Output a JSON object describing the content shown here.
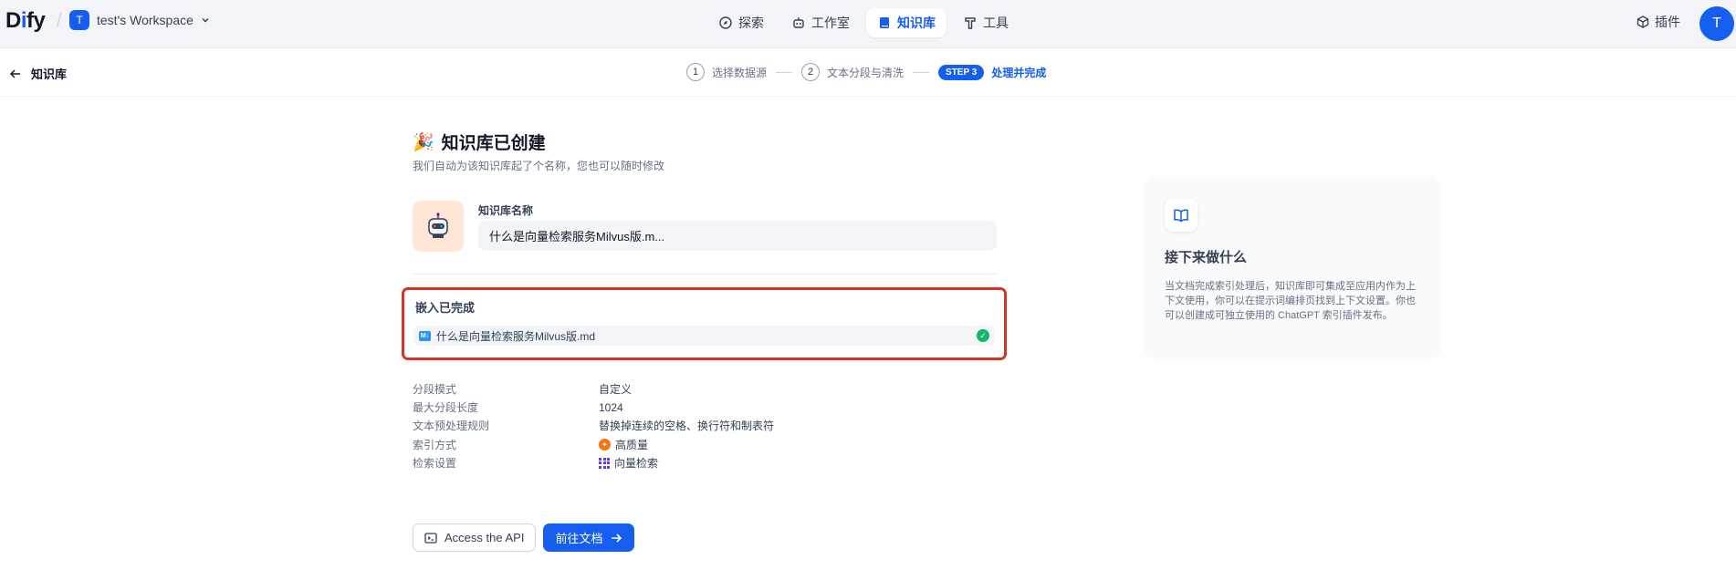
{
  "topbar": {
    "logo_d": "D",
    "logo_i": "i",
    "logo_rest": "fy",
    "workspace_badge": "T",
    "workspace_name": "test's Workspace",
    "nav": [
      {
        "label": "探索",
        "icon": "compass-icon"
      },
      {
        "label": "工作室",
        "icon": "robot-icon"
      },
      {
        "label": "知识库",
        "icon": "book-icon",
        "active": true
      },
      {
        "label": "工具",
        "icon": "tool-icon"
      }
    ],
    "plugin_label": "插件",
    "avatar_letter": "T"
  },
  "subheader": {
    "back_label": "知识库",
    "steps": [
      {
        "num": "1",
        "label": "选择数据源"
      },
      {
        "num": "2",
        "label": "文本分段与清洗"
      },
      {
        "pill": "STEP 3",
        "label": "处理并完成"
      }
    ]
  },
  "main": {
    "title_emoji": "🎉",
    "title": "知识库已创建",
    "subtitle": "我们自动为该知识库起了个名称，您也可以随时修改",
    "name_label": "知识库名称",
    "name_value": "什么是向量检索服务Milvus版.m...",
    "embed_title": "嵌入已完成",
    "file_badge": "M↓",
    "file_name": "什么是向量检索服务Milvus版.md",
    "info": [
      {
        "key": "分段模式",
        "value": "自定义"
      },
      {
        "key": "最大分段长度",
        "value": "1024"
      },
      {
        "key": "文本预处理规则",
        "value": "替换掉连续的空格、换行符和制表符"
      },
      {
        "key": "索引方式",
        "value": "高质量"
      },
      {
        "key": "检索设置",
        "value": "向量检索"
      }
    ],
    "api_button": "Access the API",
    "doc_button": "前往文档"
  },
  "next": {
    "title": "接下来做什么",
    "text": "当文档完成索引处理后，知识库即可集成至应用内作为上下文使用，你可以在提示词编排页找到上下文设置。你也可以创建成可独立使用的 ChatGPT 索引插件发布。"
  },
  "colors": {
    "accent": "#155eef",
    "highlight_border": "#d93025",
    "success": "#12b76a"
  }
}
